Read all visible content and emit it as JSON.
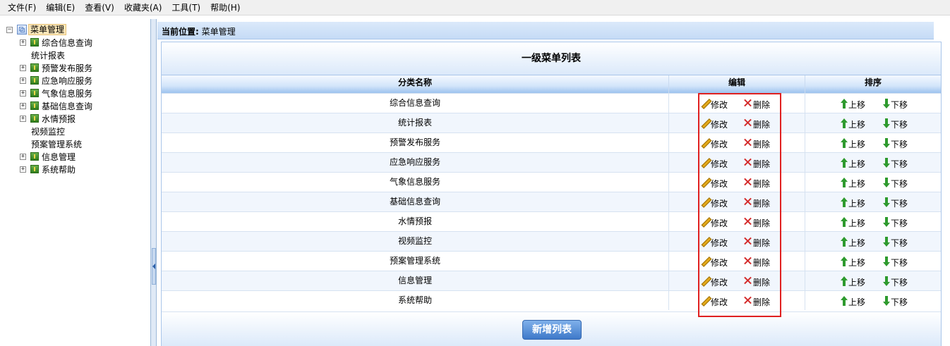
{
  "menubar": [
    "文件(F)",
    "编辑(E)",
    "查看(V)",
    "收藏夹(A)",
    "工具(T)",
    "帮助(H)"
  ],
  "tree": {
    "root": "菜单管理",
    "items": [
      {
        "label": "综合信息查询",
        "expandable": true
      },
      {
        "label": "统计报表",
        "expandable": false
      },
      {
        "label": "预警发布服务",
        "expandable": true
      },
      {
        "label": "应急响应服务",
        "expandable": true
      },
      {
        "label": "气象信息服务",
        "expandable": true
      },
      {
        "label": "基础信息查询",
        "expandable": true
      },
      {
        "label": "水情预报",
        "expandable": true
      },
      {
        "label": "视频监控",
        "expandable": false
      },
      {
        "label": "预案管理系统",
        "expandable": false
      },
      {
        "label": "信息管理",
        "expandable": true
      },
      {
        "label": "系统帮助",
        "expandable": true
      }
    ]
  },
  "location": {
    "label": "当前位置:",
    "value": "菜单管理"
  },
  "panel": {
    "title": "一级菜单列表",
    "columns": {
      "name": "分类名称",
      "edit": "编辑",
      "sort": "排序"
    },
    "actions": {
      "modify": "修改",
      "delete": "删除",
      "up": "上移",
      "down": "下移"
    },
    "rows": [
      "综合信息查询",
      "统计报表",
      "预警发布服务",
      "应急响应服务",
      "气象信息服务",
      "基础信息查询",
      "水情预报",
      "视频监控",
      "预案管理系统",
      "信息管理",
      "系统帮助"
    ],
    "add_button": "新增列表"
  }
}
